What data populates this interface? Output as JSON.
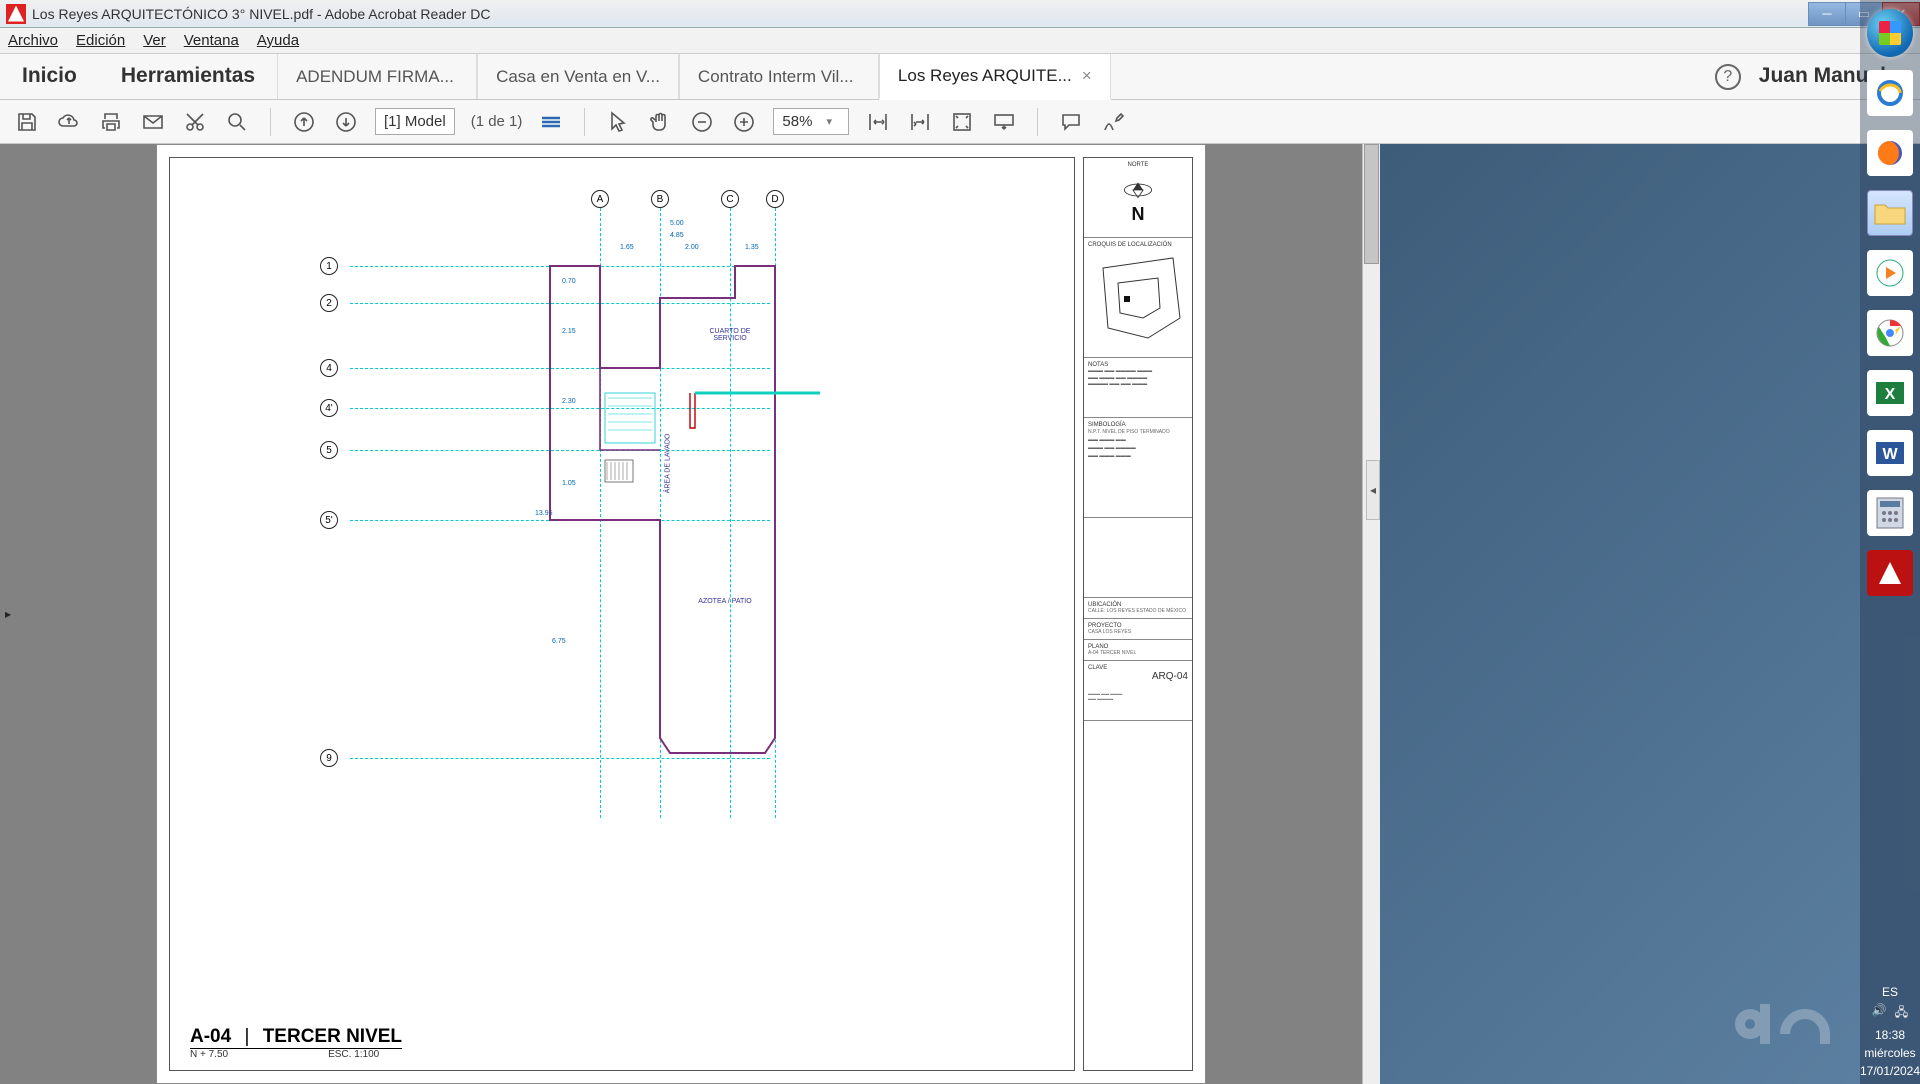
{
  "window": {
    "title": "Los Reyes ARQUITECTÓNICO 3° NIVEL.pdf - Adobe Acrobat Reader DC"
  },
  "menu": {
    "file": "Archivo",
    "edit": "Edición",
    "view": "Ver",
    "window": "Ventana",
    "help": "Ayuda"
  },
  "nav": {
    "home": "Inicio",
    "tools": "Herramientas",
    "help_tip": "?",
    "user": "Juan Manuel"
  },
  "tabs": [
    {
      "label": "ADENDUM FIRMA...",
      "active": false
    },
    {
      "label": "Casa en Venta en V...",
      "active": false
    },
    {
      "label": "Contrato Interm Vil...",
      "active": false
    },
    {
      "label": "Los Reyes ARQUITE...",
      "active": true
    }
  ],
  "toolbar": {
    "page_box": "[1] Model",
    "page_total": "(1 de 1)",
    "zoom": "58%"
  },
  "drawing": {
    "sheet_code": "A-04",
    "sheet_title": "TERCER NIVEL",
    "level_note": "N + 7.50",
    "scale": "ESC. 1:100",
    "north": "N",
    "panel": {
      "hdr_north": "NORTE",
      "hdr_loc": "CROQUIS DE LOCALIZACIÓN",
      "notes": "NOTAS",
      "simbologia": "SIMBOLOGÍA",
      "ubicacion": "UBICACIÓN",
      "ubicacion_val": "CALLE: LOS REYES ESTADO DE MÉXICO",
      "proyecto": "PROYECTO",
      "proyecto_val": "CASA LOS REYES",
      "plano": "PLANO",
      "plano_val": "A-04 TERCER NIVEL",
      "arq_code": "ARQ-04",
      "clave": "CLAVE"
    },
    "cols": [
      "A",
      "B",
      "C",
      "D"
    ],
    "rows": [
      "1",
      "2",
      "4",
      "4'",
      "5",
      "5'",
      "9"
    ],
    "dims": {
      "top_total": "5.00",
      "top_ab": "1.65",
      "top_bc": "2.00",
      "top_cd": "1.35",
      "top_total2": "4.85",
      "r12": "0.70",
      "r24": "2.15",
      "r44p": "2.30",
      "r4p5": "1.05",
      "r55p": "13.95",
      "r5p9": "6.75"
    },
    "rooms": {
      "servicio": "CUARTO DE SERVICIO",
      "lavado": "ÁREA DE LAVADO",
      "azotea": "AZOTEA / PATIO"
    }
  },
  "tray": {
    "lang": "ES",
    "time": "18:38",
    "day": "miércoles",
    "date": "17/01/2024"
  }
}
